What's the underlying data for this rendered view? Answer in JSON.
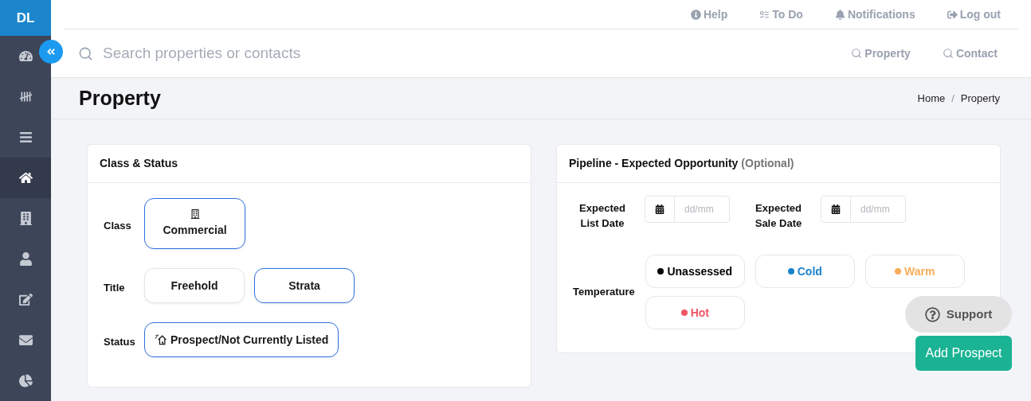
{
  "sidebar": {
    "logo": "DL",
    "items": [
      {
        "kind": "dashboard",
        "selected": false
      },
      {
        "kind": "tally",
        "selected": false
      },
      {
        "kind": "list",
        "selected": false
      },
      {
        "kind": "home",
        "selected": true
      },
      {
        "kind": "building",
        "selected": false
      },
      {
        "kind": "user",
        "selected": false
      },
      {
        "kind": "edit",
        "selected": false
      },
      {
        "kind": "mail",
        "selected": false
      },
      {
        "kind": "chart",
        "selected": false
      }
    ]
  },
  "top_links": [
    {
      "kind": "help",
      "label": "Help"
    },
    {
      "kind": "todo",
      "label": "To Do"
    },
    {
      "kind": "bell",
      "label": "Notifications"
    },
    {
      "kind": "logout",
      "label": "Log out"
    }
  ],
  "search": {
    "placeholder": "Search properties or contacts"
  },
  "search_links": [
    "Property",
    "Contact"
  ],
  "page_title": "Property",
  "breadcrumb": [
    "Home",
    "Property"
  ],
  "breadcrumb_separator": "/",
  "class_status": {
    "title": "Class & Status",
    "rows": [
      {
        "label": "Class",
        "options": [
          {
            "kind": "building",
            "label": "Commercial",
            "selected": true
          }
        ]
      },
      {
        "label": "Title",
        "options": [
          {
            "label": "Freehold",
            "selected": false
          },
          {
            "label": "Strata",
            "selected": true
          }
        ]
      },
      {
        "label": "Status",
        "options": [
          {
            "kind": "prospect",
            "label": "Prospect/Not Currently Listed",
            "selected": true
          }
        ]
      }
    ]
  },
  "pipeline": {
    "title": "Pipeline - Expected Opportunity",
    "title_note": "(Optional)",
    "dates": [
      {
        "label": "Expected List Date",
        "placeholder": "dd/mm"
      },
      {
        "label": "Expected Sale Date",
        "placeholder": "dd/mm"
      }
    ],
    "temperature_label": "Temperature",
    "temperatures": [
      {
        "label": "Unassessed",
        "color": "#000000",
        "selected": false
      },
      {
        "label": "Cold",
        "color": "#1b82cc",
        "selected": false
      },
      {
        "label": "Warm",
        "color": "#f8ac59",
        "selected": false
      },
      {
        "label": "Hot",
        "color": "#ed5565",
        "selected": false
      }
    ]
  },
  "support_button": "Support",
  "add_button": "Add Prospect"
}
